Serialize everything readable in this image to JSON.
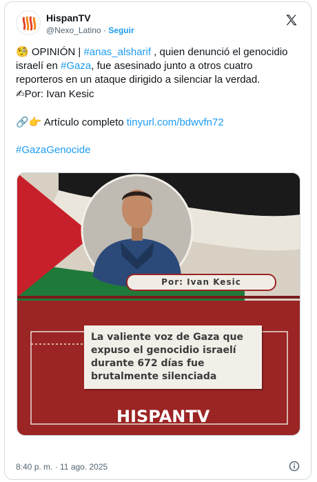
{
  "account": {
    "display_name": "HispanTV",
    "handle": "@Nexo_Latino",
    "separator": "·",
    "follow_label": "Seguir"
  },
  "tweet": {
    "line1_emoji": "🧐",
    "line1_prefix": " OPINIÓN | ",
    "hashtag_anas": "#anas_alsharif",
    "line1_rest": " , quien denunció el genocidio israelí en ",
    "hashtag_gaza": "#Gaza",
    "line1_tail": ", fue asesinado junto a otros cuatro reporteros en un ataque dirigido a silenciar la verdad.",
    "author_emoji": "✍",
    "author_line": "Por: Ivan Kesic",
    "article_emojis": "🔗👉",
    "article_label": "Artículo completo ",
    "article_link": "tinyurl.com/bdwvfn72",
    "hashtag_genocide": "#GazaGenocide"
  },
  "media": {
    "author_tag": "Por: Ivan Kesic",
    "caption": "La valiente voz de Gaza que expuso el genocidio israelí durante 672 días fue brutalmente silenciada",
    "brand": "HISPANTV"
  },
  "footer": {
    "timestamp": "8:40 p. m. · 11 ago. 2025"
  },
  "colors": {
    "link": "#1d9bf0",
    "poster_red": "#9b2424",
    "flag_green": "#1f7a3a",
    "flag_red": "#c8202a"
  }
}
